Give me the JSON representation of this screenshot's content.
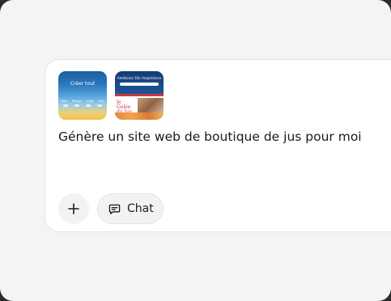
{
  "composer": {
    "attachments": [
      {
        "title": "Créer tout",
        "categories": [
          "Todo",
          "Mango",
          "Code",
          "Tout"
        ]
      },
      {
        "title": "Améliorez 10x l'expérience",
        "brand": "le Gelée du Jus"
      }
    ],
    "prompt_text": "Génère un site web de boutique de jus pour moi",
    "add_icon": "plus-icon",
    "chat_icon": "chat-bubble-icon",
    "chat_label": "Chat"
  }
}
